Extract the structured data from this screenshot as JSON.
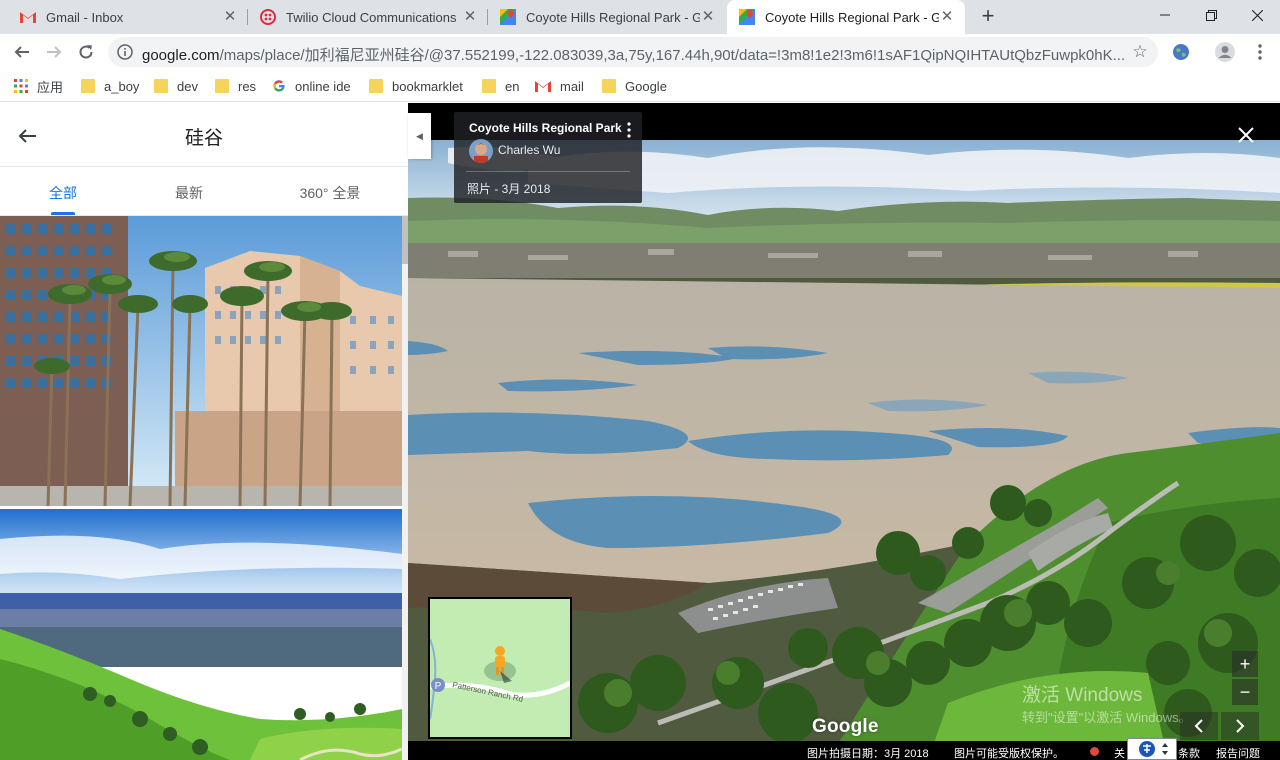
{
  "tabs": [
    {
      "title": "Gmail - Inbox",
      "icon": "gmail-icon",
      "active": false
    },
    {
      "title": "Twilio Cloud Communications",
      "icon": "twilio-icon",
      "active": false
    },
    {
      "title": "Coyote Hills Regional Park - G",
      "icon": "maps-icon",
      "active": false
    },
    {
      "title": "Coyote Hills Regional Park - G",
      "icon": "maps-icon",
      "active": true
    }
  ],
  "address": {
    "host": "google.com",
    "path": "/maps/place/加利福尼亚州硅谷/@37.552199,-122.083039,3a,75y,167.44h,90t/data=!3m8!1e2!3m6!1sAF1QipNQIHTAUtQbzFuwpk0hK..."
  },
  "bookmarks": [
    {
      "label": "应用",
      "icon": "apps-grid-icon"
    },
    {
      "label": "a_boy",
      "icon": "folder-icon"
    },
    {
      "label": "dev",
      "icon": "folder-icon"
    },
    {
      "label": "res",
      "icon": "folder-icon"
    },
    {
      "label": "online ide",
      "icon": "google-g-icon"
    },
    {
      "label": "bookmarklet",
      "icon": "folder-icon"
    },
    {
      "label": "en",
      "icon": "folder-icon"
    },
    {
      "label": "mail",
      "icon": "gmail-icon"
    },
    {
      "label": "Google",
      "icon": "folder-icon"
    }
  ],
  "panel": {
    "title": "硅谷",
    "tabs": [
      "全部",
      "最新",
      "360° 全景"
    ],
    "active_tab": 0
  },
  "viewer": {
    "place_name": "Coyote Hills Regional Park",
    "author": "Charles Wu",
    "photo_date": "照片 - 3月 2018",
    "watermark_logo": "Google",
    "minimap_road": "Patterson Ranch Rd",
    "zoom_in": "+",
    "zoom_out": "−"
  },
  "footer": {
    "capture_date": "图片拍摄日期：3月 2018",
    "copyright": "图片可能受版权保护。",
    "about": "关",
    "terms": "条款",
    "report": "报告问题"
  },
  "os_overlay": {
    "activate_title": "激活 Windows",
    "activate_hint": "转到\"设置\"以激活 Windows。"
  },
  "colors": {
    "accent": "#1a73e8",
    "tabstrip": "#dee1e6",
    "viewer_bg": "#000000"
  }
}
